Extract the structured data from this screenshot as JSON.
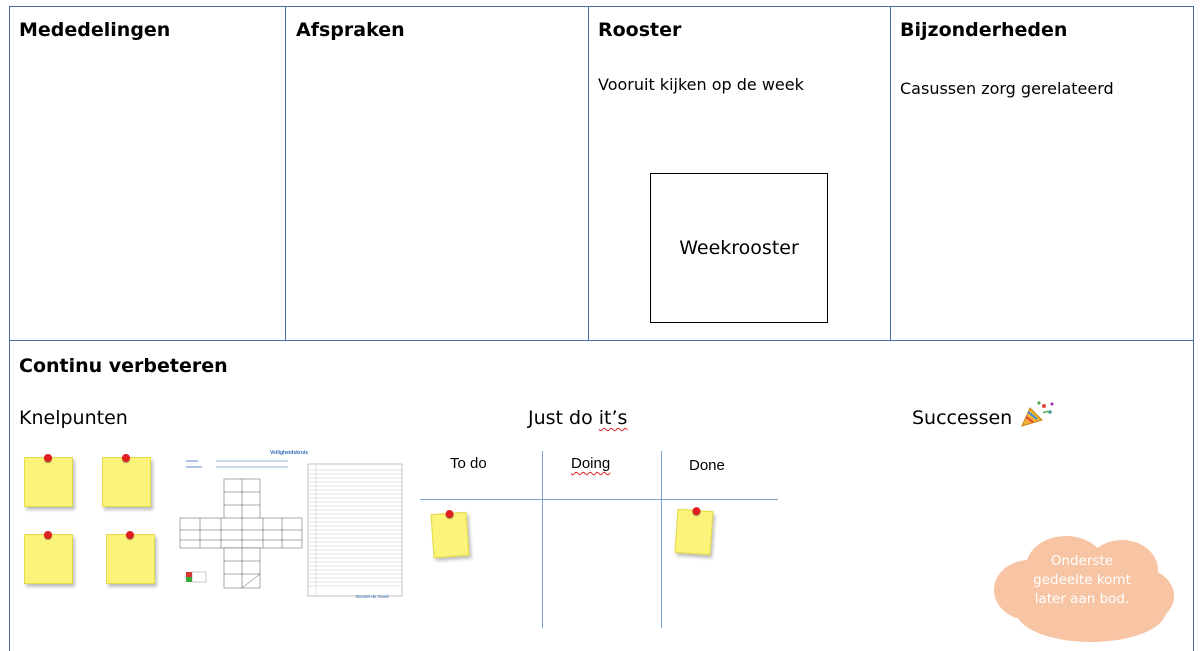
{
  "top": {
    "mededelingen": {
      "title": "Mededelingen"
    },
    "afspraken": {
      "title": "Afspraken"
    },
    "rooster": {
      "title": "Rooster",
      "subtitle": "Vooruit kijken op de week",
      "box_label": "Weekrooster"
    },
    "bijzonderheden": {
      "title": "Bijzonderheden",
      "subtitle": "Casussen zorg gerelateerd"
    }
  },
  "bottom": {
    "title": "Continu verbeteren",
    "knelpunten": {
      "label": "Knelpunten"
    },
    "justdoits": {
      "label_a": "Just do ",
      "label_b": "it’s",
      "cols": [
        "To do",
        "Doing",
        "Done"
      ]
    },
    "successen": {
      "label": "Successen",
      "icon": "party-popper-icon"
    },
    "veiligheidskruis": {
      "title": "Veiligheidskruis",
      "footer": "Borstel de Goed"
    },
    "cloud": {
      "line1": "Onderste",
      "line2": "gedeelte komt",
      "line3": "later aan bod."
    }
  },
  "colors": {
    "border": "#4a6fa5",
    "note": "#fbf37a",
    "pin": "#e02020",
    "cloud": "#f7c4a4"
  }
}
